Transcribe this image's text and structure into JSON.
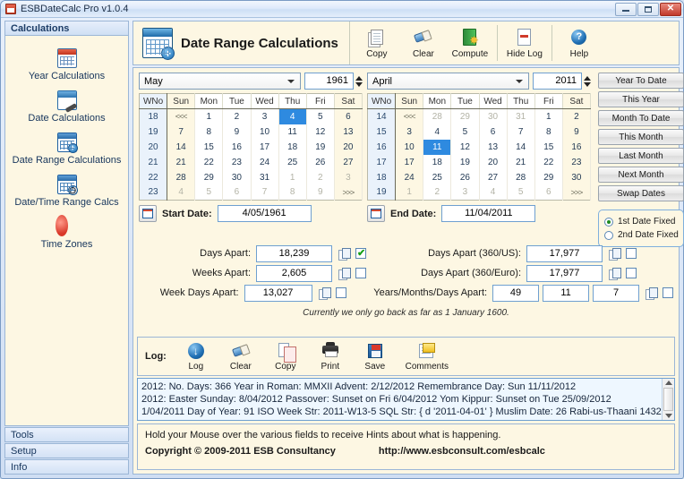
{
  "window": {
    "title": "ESBDateCalc Pro v1.0.4",
    "minimize": "–",
    "maximize": "□",
    "close": "✕"
  },
  "sidebar": {
    "header": "Calculations",
    "items": [
      {
        "label": "Year Calculations",
        "icon": "calendar-red-icon"
      },
      {
        "label": "Date Calculations",
        "icon": "calendar-wrench-icon"
      },
      {
        "label": "Date Range Calculations",
        "icon": "calendar-plus-icon"
      },
      {
        "label": "Date/Time Range Calcs",
        "icon": "calendar-clock-icon"
      },
      {
        "label": "Time Zones",
        "icon": "globe-icon"
      }
    ],
    "footer": [
      "Tools",
      "Setup",
      "Info"
    ]
  },
  "header": {
    "title": "Date Range Calculations",
    "icon": "calendar-plus-icon",
    "toolbar": [
      {
        "label": "Copy",
        "icon": "copy-icon"
      },
      {
        "label": "Clear",
        "icon": "eraser-icon"
      },
      {
        "label": "Compute",
        "icon": "compute-icon"
      },
      {
        "label": "Hide Log",
        "icon": "hide-log-icon"
      },
      {
        "label": "Help",
        "icon": "help-icon"
      }
    ]
  },
  "calendars": {
    "weekday_headers": [
      "WNo",
      "Sun",
      "Mon",
      "Tue",
      "Wed",
      "Thu",
      "Fri",
      "Sat"
    ],
    "prev_nav": "<<<",
    "next_nav": ">>>",
    "start": {
      "month": "May",
      "year": "1961",
      "date_label": "Start Date:",
      "date_value": "4/05/1961",
      "selected_day": 4,
      "weeks": [
        {
          "wno": "18",
          "days": [
            {
              "t": "<<<",
              "type": "nav"
            },
            {
              "t": "1",
              "type": "cur"
            },
            {
              "t": "2",
              "type": "cur"
            },
            {
              "t": "3",
              "type": "cur"
            },
            {
              "t": "4",
              "type": "sel"
            },
            {
              "t": "5",
              "type": "cur"
            },
            {
              "t": "6",
              "type": "cur"
            }
          ]
        },
        {
          "wno": "19",
          "days": [
            {
              "t": "7",
              "type": "cur"
            },
            {
              "t": "8",
              "type": "cur"
            },
            {
              "t": "9",
              "type": "cur"
            },
            {
              "t": "10",
              "type": "cur"
            },
            {
              "t": "11",
              "type": "cur"
            },
            {
              "t": "12",
              "type": "cur"
            },
            {
              "t": "13",
              "type": "cur"
            }
          ]
        },
        {
          "wno": "20",
          "days": [
            {
              "t": "14",
              "type": "cur"
            },
            {
              "t": "15",
              "type": "cur"
            },
            {
              "t": "16",
              "type": "cur"
            },
            {
              "t": "17",
              "type": "cur"
            },
            {
              "t": "18",
              "type": "cur"
            },
            {
              "t": "19",
              "type": "cur"
            },
            {
              "t": "20",
              "type": "cur"
            }
          ]
        },
        {
          "wno": "21",
          "days": [
            {
              "t": "21",
              "type": "cur"
            },
            {
              "t": "22",
              "type": "cur"
            },
            {
              "t": "23",
              "type": "cur"
            },
            {
              "t": "24",
              "type": "cur"
            },
            {
              "t": "25",
              "type": "cur"
            },
            {
              "t": "26",
              "type": "cur"
            },
            {
              "t": "27",
              "type": "cur"
            }
          ]
        },
        {
          "wno": "22",
          "days": [
            {
              "t": "28",
              "type": "cur"
            },
            {
              "t": "29",
              "type": "cur"
            },
            {
              "t": "30",
              "type": "cur"
            },
            {
              "t": "31",
              "type": "cur"
            },
            {
              "t": "1",
              "type": "other"
            },
            {
              "t": "2",
              "type": "other"
            },
            {
              "t": "3",
              "type": "other"
            }
          ]
        },
        {
          "wno": "23",
          "days": [
            {
              "t": "4",
              "type": "other"
            },
            {
              "t": "5",
              "type": "other"
            },
            {
              "t": "6",
              "type": "other"
            },
            {
              "t": "7",
              "type": "other"
            },
            {
              "t": "8",
              "type": "other"
            },
            {
              "t": "9",
              "type": "other"
            },
            {
              "t": ">>>",
              "type": "nav"
            }
          ]
        }
      ]
    },
    "end": {
      "month": "April",
      "year": "2011",
      "date_label": "End Date:",
      "date_value": "11/04/2011",
      "selected_day": 11,
      "weeks": [
        {
          "wno": "14",
          "days": [
            {
              "t": "<<<",
              "type": "nav"
            },
            {
              "t": "28",
              "type": "other"
            },
            {
              "t": "29",
              "type": "other"
            },
            {
              "t": "30",
              "type": "other"
            },
            {
              "t": "31",
              "type": "other"
            },
            {
              "t": "1",
              "type": "cur"
            },
            {
              "t": "2",
              "type": "cur"
            }
          ]
        },
        {
          "wno": "15",
          "days": [
            {
              "t": "3",
              "type": "cur"
            },
            {
              "t": "4",
              "type": "cur"
            },
            {
              "t": "5",
              "type": "cur"
            },
            {
              "t": "6",
              "type": "cur"
            },
            {
              "t": "7",
              "type": "cur"
            },
            {
              "t": "8",
              "type": "cur"
            },
            {
              "t": "9",
              "type": "cur"
            }
          ]
        },
        {
          "wno": "16",
          "days": [
            {
              "t": "10",
              "type": "cur"
            },
            {
              "t": "11",
              "type": "sel"
            },
            {
              "t": "12",
              "type": "cur"
            },
            {
              "t": "13",
              "type": "cur"
            },
            {
              "t": "14",
              "type": "cur"
            },
            {
              "t": "15",
              "type": "cur"
            },
            {
              "t": "16",
              "type": "cur"
            }
          ]
        },
        {
          "wno": "17",
          "days": [
            {
              "t": "17",
              "type": "cur"
            },
            {
              "t": "18",
              "type": "cur"
            },
            {
              "t": "19",
              "type": "cur"
            },
            {
              "t": "20",
              "type": "cur"
            },
            {
              "t": "21",
              "type": "cur"
            },
            {
              "t": "22",
              "type": "cur"
            },
            {
              "t": "23",
              "type": "cur"
            }
          ]
        },
        {
          "wno": "18",
          "days": [
            {
              "t": "24",
              "type": "cur"
            },
            {
              "t": "25",
              "type": "cur"
            },
            {
              "t": "26",
              "type": "cur"
            },
            {
              "t": "27",
              "type": "cur"
            },
            {
              "t": "28",
              "type": "cur"
            },
            {
              "t": "29",
              "type": "cur"
            },
            {
              "t": "30",
              "type": "cur"
            }
          ]
        },
        {
          "wno": "19",
          "days": [
            {
              "t": "1",
              "type": "other"
            },
            {
              "t": "2",
              "type": "other"
            },
            {
              "t": "3",
              "type": "other"
            },
            {
              "t": "4",
              "type": "other"
            },
            {
              "t": "5",
              "type": "other"
            },
            {
              "t": "6",
              "type": "other"
            },
            {
              "t": ">>>",
              "type": "nav"
            }
          ]
        }
      ]
    }
  },
  "quick_buttons": [
    "Year To Date",
    "This Year",
    "Month To Date",
    "This Month",
    "Last Month",
    "Next Month",
    "Swap Dates"
  ],
  "fixed_radio": {
    "first": "1st Date Fixed",
    "second": "2nd Date Fixed",
    "selected": "first"
  },
  "results": {
    "left": [
      {
        "label": "Days Apart:",
        "value": "18,239",
        "checked": true
      },
      {
        "label": "Weeks Apart:",
        "value": "2,605",
        "checked": false
      },
      {
        "label": "Week Days Apart:",
        "value": "13,027",
        "checked": false
      }
    ],
    "right": [
      {
        "label": "Days Apart (360/US):",
        "value": "17,977",
        "checked": false
      },
      {
        "label": "Days Apart (360/Euro):",
        "value": "17,977",
        "checked": false
      }
    ],
    "ymd": {
      "label": "Years/Months/Days Apart:",
      "years": "49",
      "months": "11",
      "days": "7",
      "checked": false
    },
    "note": "Currently we only go back as far as 1 January 1600."
  },
  "log": {
    "word": "Log:",
    "buttons": [
      {
        "label": "Log",
        "icon": "download-icon"
      },
      {
        "label": "Clear",
        "icon": "eraser-icon"
      },
      {
        "label": "Copy",
        "icon": "copy-icon"
      },
      {
        "label": "Print",
        "icon": "printer-icon"
      },
      {
        "label": "Save",
        "icon": "floppy-disk-icon"
      },
      {
        "label": "Comments",
        "icon": "comments-icon"
      }
    ],
    "lines": [
      "2012:   No. Days: 366 Year in Roman: MMXII Advent: 2/12/2012 Remembrance Day: Sun 11/11/2012",
      "2012:   Easter Sunday: 8/04/2012 Passover: Sunset on Fri 6/04/2012 Yom Kippur: Sunset on Tue 25/09/2012",
      "1/04/2011   Day of Year: 91 ISO Week Str: 2011-W13-5 SQL Str: { d '2011-04-01' } Muslim Date: 26 Rabi-us-Thaani 1432"
    ]
  },
  "status": {
    "hint": "Hold your Mouse over the various fields to receive Hints about what is happening.",
    "copyright": "Copyright © 2009-2011 ESB Consultancy",
    "url": "http://www.esbconsult.com/esbcalc"
  }
}
